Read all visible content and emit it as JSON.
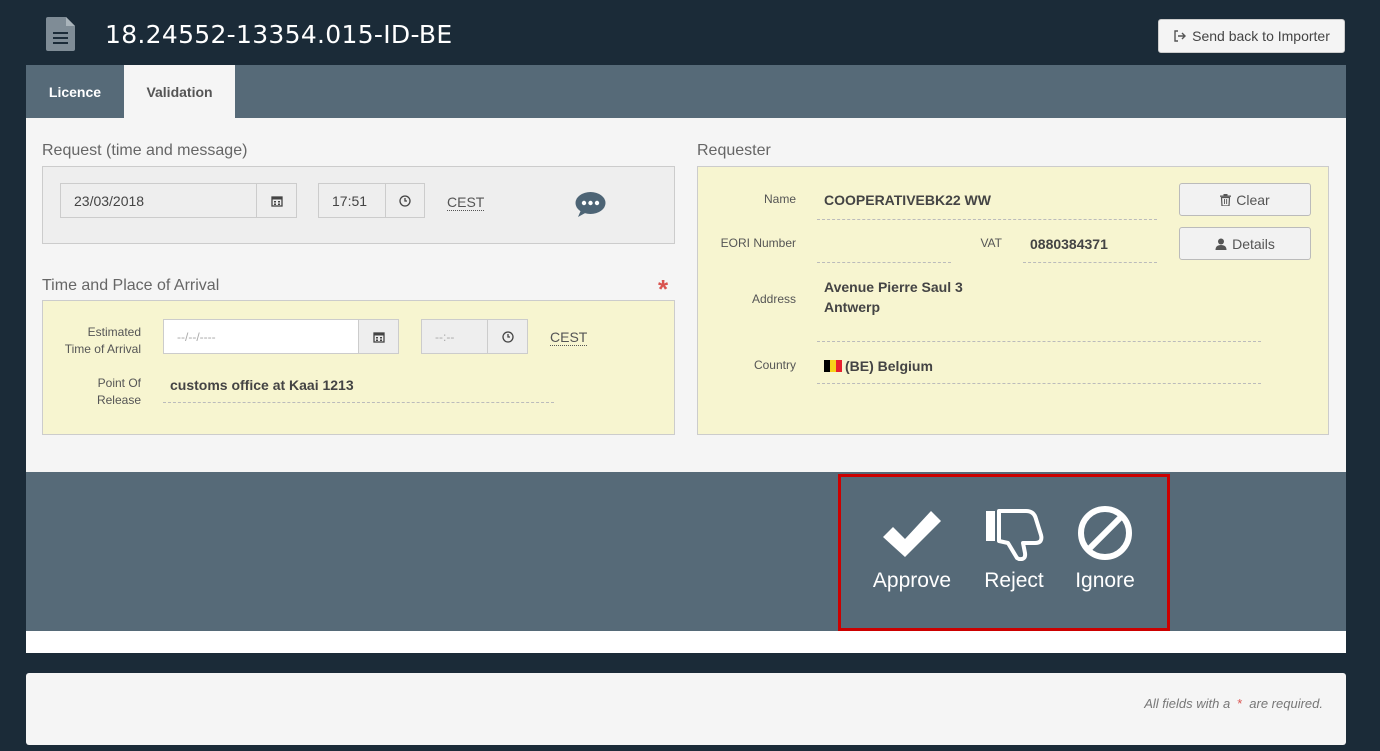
{
  "header": {
    "title": "18.24552-13354.015-ID-BE",
    "send_back_label": "Send back to Importer"
  },
  "tabs": [
    {
      "label": "Licence",
      "active": false
    },
    {
      "label": "Validation",
      "active": true
    }
  ],
  "request": {
    "section_label": "Request (time and message)",
    "date": "23/03/2018",
    "time": "17:51",
    "timezone": "CEST"
  },
  "arrival": {
    "section_label": "Time and Place of Arrival",
    "eta_label_line1": "Estimated",
    "eta_label_line2": "Time of Arrival",
    "eta_date_placeholder": "--/--/----",
    "eta_time_placeholder": "--:--",
    "timezone": "CEST",
    "release_label_line1": "Point Of",
    "release_label_line2": "Release",
    "release_value": "customs office at Kaai 1213",
    "required_marker": "*"
  },
  "requester": {
    "section_label": "Requester",
    "name_label": "Name",
    "name_value": "COOPERATIVEBK22 WW",
    "eori_label": "EORI Number",
    "eori_value": "",
    "vat_label": "VAT",
    "vat_value": "0880384371",
    "address_label": "Address",
    "address_line1": "Avenue Pierre Saul 3",
    "address_line2": "Antwerp",
    "country_label": "Country",
    "country_value": "(BE) Belgium",
    "clear_label": "Clear",
    "details_label": "Details"
  },
  "actions": {
    "approve_label": "Approve",
    "reject_label": "Reject",
    "ignore_label": "Ignore"
  },
  "footer": {
    "note_prefix": "All fields with a",
    "note_star": "*",
    "note_suffix": "are required."
  },
  "colors": {
    "background": "#1b2b38",
    "bar": "#566a78",
    "panel": "#f5f5f5",
    "highlight_field": "#f7f5d0",
    "required": "#d9534f",
    "highlight_frame": "#cc0000"
  }
}
